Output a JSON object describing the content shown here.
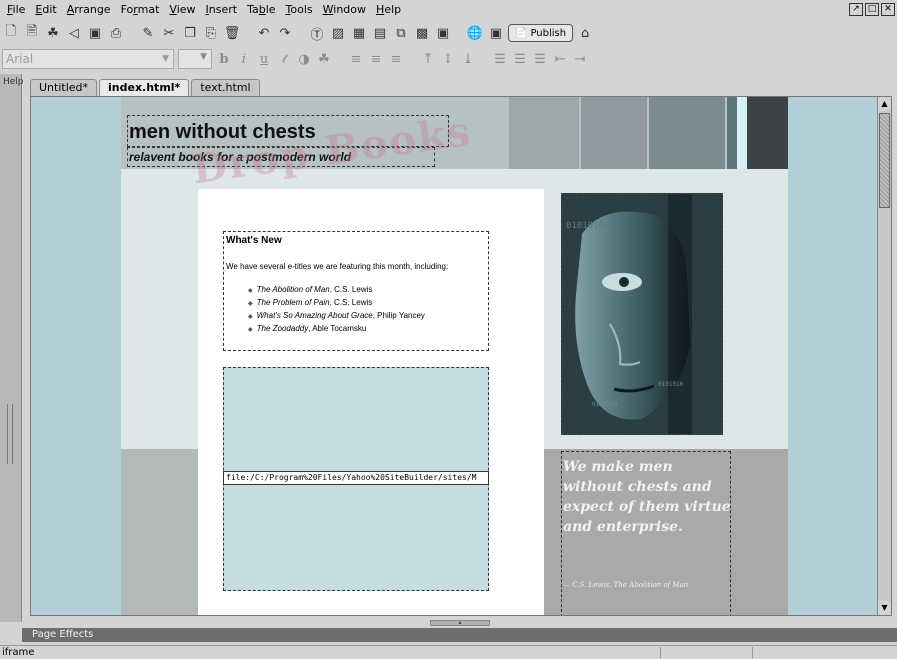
{
  "menu": [
    "File",
    "Edit",
    "Arrange",
    "Format",
    "View",
    "Insert",
    "Table",
    "Tools",
    "Window",
    "Help"
  ],
  "menu_mnemonic_index": [
    0,
    0,
    0,
    2,
    0,
    0,
    2,
    0,
    0,
    0
  ],
  "window_controls": [
    "restore",
    "maximize",
    "close"
  ],
  "toolbar": {
    "publish_label": "Publish",
    "icons": [
      "new-page-icon",
      "open-icon",
      "site-map-icon",
      "back-icon",
      "save-icon",
      "print-icon",
      "format-painter-icon",
      "cut-icon",
      "copy-icon",
      "paste-icon",
      "delete-icon",
      "undo-icon",
      "redo-icon",
      "text-icon",
      "image-icon",
      "table-icon",
      "form-icon",
      "link-icon",
      "grid-icon",
      "frame-icon",
      "web-icon",
      "preview-icon"
    ]
  },
  "format_bar": {
    "font": "Arial",
    "size": "",
    "bold": "b",
    "italic": "i",
    "underline": "u"
  },
  "help_tab_label": "Help",
  "tabs": [
    "Untitled*",
    "index.html*",
    "text.html"
  ],
  "active_tab": 1,
  "page": {
    "site_title": "men without chests",
    "site_subtitle": "relavent books for a postmodern world",
    "watermark": "Drop Books",
    "swatch_colors": [
      "#b5c1c3",
      "#9ea7aa",
      "#8e9a9d",
      "#7a8c90",
      "#5f777c",
      "#d8f0f5",
      "#3c4245"
    ],
    "news": {
      "title": "What's New",
      "intro": "We have several e-titles we are featuring this month, including:",
      "items": [
        {
          "book": "The Abolition of Man",
          "author": ", C.S. Lewis"
        },
        {
          "book": "The Problem of Pain",
          "author": ", C.S. Lewis"
        },
        {
          "book": "What's So Amazing About Grace",
          "author": ", Philip Yancey"
        },
        {
          "book": "The Zoodaddy",
          "author": ", Able Tocamsku"
        }
      ]
    },
    "iframe_path": "file:/C:/Program%20Files/Yahoo%20SiteBuilder/sites/M",
    "quote": "We make men without chests and expect of them virtue and enterprise.",
    "quote_credit": "— C.S. Lewis, The Abolition of Man"
  },
  "panel_label": "Page Effects",
  "status_text": "iframe"
}
